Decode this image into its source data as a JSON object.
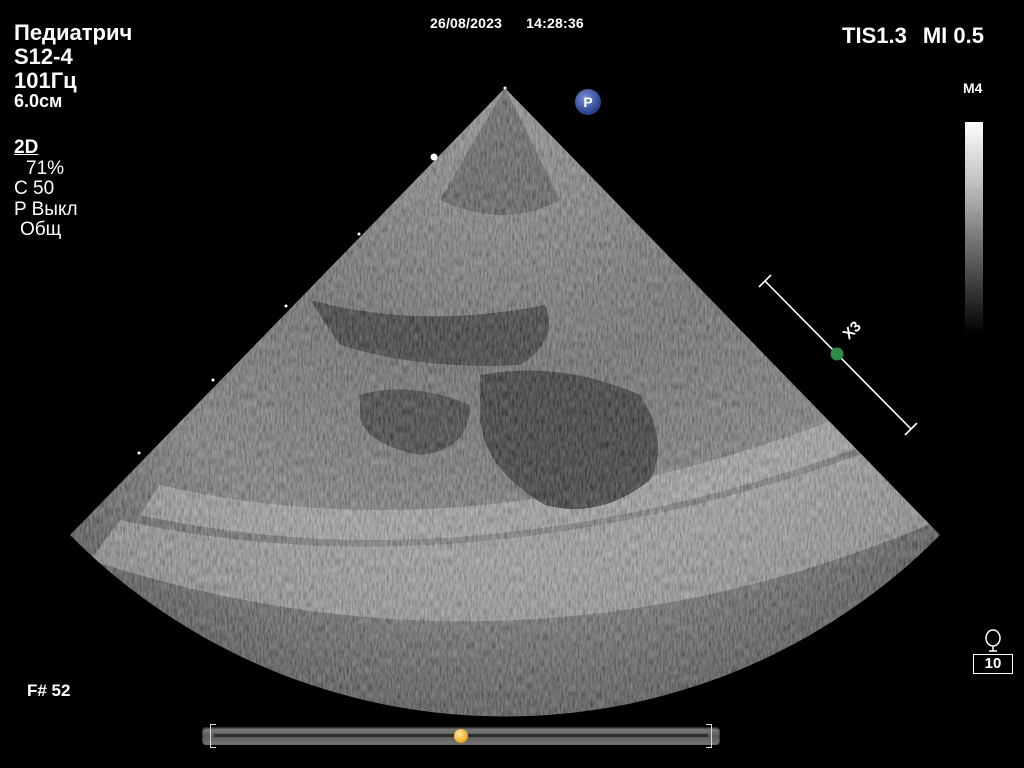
{
  "header": {
    "preset": "Педиатрич",
    "probe": "S12-4",
    "frame_rate": "101Гц",
    "depth": "6.0см",
    "date": "26/08/2023",
    "time": "14:28:36",
    "tis": "TIS1.3",
    "mi": "MI 0.5"
  },
  "params": {
    "mode": "2D",
    "gain": "71%",
    "compression": "C 50",
    "persistence": "P Выкл",
    "preset_type": "Общ"
  },
  "grayscale": {
    "map_label": "M4"
  },
  "overlay": {
    "orientation_marker": "P",
    "zoom_label": "X3"
  },
  "footer": {
    "frame_number": "F# 52",
    "cine_position": 0.5,
    "probe_value": "10"
  },
  "icons": {
    "probe_icon": "probe-icon",
    "orientation_marker": "p-marker-icon"
  },
  "colors": {
    "background": "#000000",
    "text": "#ffffff",
    "p_marker": "#2d468f",
    "zoom_dot": "#2e8b45",
    "cine_handle": "#f0b030"
  }
}
